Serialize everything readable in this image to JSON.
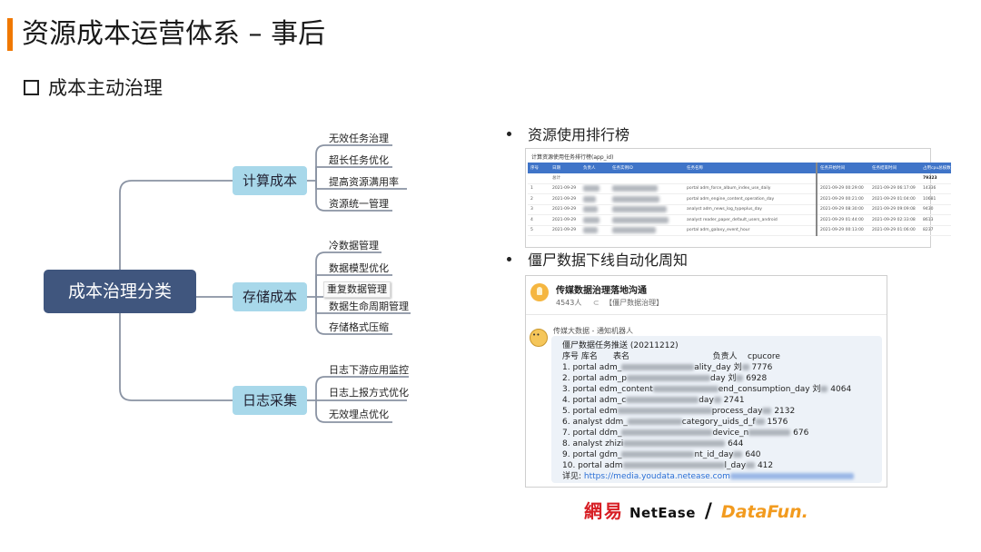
{
  "header": {
    "title": "资源成本运营体系 – 事后",
    "subtitle": "成本主动治理"
  },
  "mindmap": {
    "root": "成本治理分类",
    "categories": [
      {
        "label": "计算成本",
        "leaves": [
          "无效任务治理",
          "超长任务优化",
          "提高资源满用率",
          "资源统一管理"
        ]
      },
      {
        "label": "存储成本",
        "leaves": [
          "冷数据管理",
          "数据模型优化",
          "重复数据管理",
          "数据生命周期管理",
          "存储格式压缩"
        ]
      },
      {
        "label": "日志采集",
        "leaves": [
          "日志下游应用监控",
          "日志上报方式优化",
          "无效埋点优化"
        ]
      }
    ]
  },
  "ranking": {
    "bullet": "资源使用排行榜",
    "panel_title": "计算资源使用任务排行榜(app_id)",
    "columns": [
      "序号",
      "日期",
      "负责人",
      "任务实例ID",
      "任务名称",
      "任务开始时间",
      "任务结束时间",
      "占用cpu总核数"
    ],
    "total_row": [
      "",
      "总计",
      "",
      "",
      "",
      "",
      "",
      "79323"
    ],
    "rows": [
      [
        "1",
        "2021-09-29",
        "",
        "",
        "portal adm_force_album_index_use_daily",
        "2021-09-29 00:29:00",
        "2021-09-29 06:17:09",
        "14336"
      ],
      [
        "2",
        "2021-09-29",
        "",
        "",
        "portal adm_engine_content_operation_day",
        "2021-09-29 00:21:00",
        "2021-09-29 01:04:00",
        "10681"
      ],
      [
        "3",
        "2021-09-29",
        "",
        "",
        "analyst adm_news_log_typeplus_day",
        "2021-09-29 08:30:00",
        "2021-09-29 09:09:08",
        "9430"
      ],
      [
        "4",
        "2021-09-29",
        "",
        "",
        "analyst reader_paper_default_users_android",
        "2021-09-29 01:44:00",
        "2021-09-29 02:33:08",
        "8613"
      ],
      [
        "5",
        "2021-09-29",
        "",
        "",
        "portal adm_galaxy_event_hour",
        "2021-09-29 00:13:00",
        "2021-09-29 01:06:00",
        "8237"
      ]
    ]
  },
  "zombie": {
    "bullet": "僵尸数据下线自动化周知",
    "chat_name": "传媒数据治理落地沟通",
    "members": "4543人",
    "tag": "【僵尸数据治理】",
    "sender": "传媒大数据 - 通知机器人",
    "heading": "僵尸数据任务推送 (20211212)",
    "col_header": "序号 库名      表名                                负责人    cpucore",
    "lines": [
      {
        "prefix": "1. portal adm_",
        "suffix": "ality_day 刘",
        "value": "7776"
      },
      {
        "prefix": "2. portal adm_p",
        "suffix": "day 刘",
        "value": "6928"
      },
      {
        "prefix": "3. portal edm_content",
        "suffix": "end_consumption_day 刘",
        "value": "4064"
      },
      {
        "prefix": "4. portal adm_c",
        "suffix": "day",
        "value": "2741"
      },
      {
        "prefix": "5. portal edm",
        "suffix": "process_day",
        "value": "2132"
      },
      {
        "prefix": "6. analyst ddm_",
        "suffix": "category_uids_d_f",
        "value": "1576"
      },
      {
        "prefix": "7. portal ddm_",
        "suffix": "device_n",
        "value": "676"
      },
      {
        "prefix": "8. analyst zhizi",
        "suffix": "",
        "value": "644"
      },
      {
        "prefix": "9. portal gdm_",
        "suffix": "nt_id_day",
        "value": "640"
      },
      {
        "prefix": "10. portal adm",
        "suffix": "l_day",
        "value": "412"
      }
    ],
    "detail_label": "详见:",
    "detail_link": "https://media.youdata.netease.com"
  },
  "footer": {
    "logo_cn": "網易",
    "logo_en": "NetEase",
    "separator": "/",
    "logo_df": "DataFun."
  },
  "colors": {
    "accent": "#f07800",
    "root": "#40567e",
    "category": "#a8d8ea",
    "table_header": "#3f74c8"
  }
}
